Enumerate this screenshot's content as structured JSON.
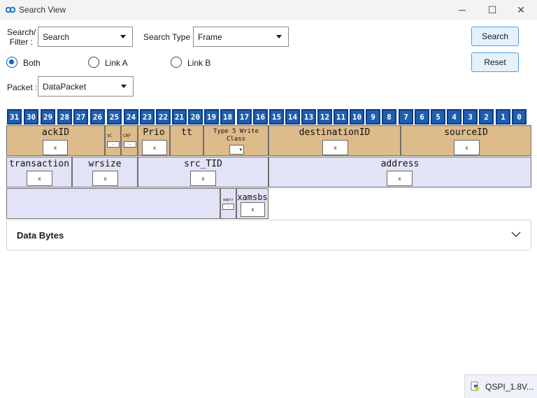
{
  "window": {
    "title": "Search View",
    "minimize_glyph": "─",
    "maximize_glyph": "☐",
    "close_glyph": "✕"
  },
  "filter": {
    "search_filter_label_line1": "Search/",
    "search_filter_label_line2": "Filter :",
    "search_filter_value": "Search",
    "search_type_label": "Search Type :",
    "search_type_value": "Frame",
    "radio_both": "Both",
    "radio_link_a": "Link A",
    "radio_link_b": "Link B",
    "radio_selected": "Both",
    "packet_label": "Packet :",
    "packet_value": "DataPacket"
  },
  "buttons": {
    "search": "Search",
    "reset": "Reset"
  },
  "bits": [
    "31",
    "30",
    "29",
    "28",
    "27",
    "26",
    "25",
    "24",
    "23",
    "22",
    "21",
    "20",
    "19",
    "18",
    "17",
    "16",
    "15",
    "14",
    "13",
    "12",
    "11",
    "10",
    "9",
    "8",
    "7",
    "6",
    "5",
    "4",
    "3",
    "2",
    "1",
    "0"
  ],
  "fields": {
    "row1": {
      "ackID": {
        "name": "ackID",
        "value": "x"
      },
      "vc": {
        "name": "VC",
        "value": "-"
      },
      "crf": {
        "name": "CRF",
        "value": "-"
      },
      "prio": {
        "name": "Prio",
        "value": "x"
      },
      "tt": {
        "name": "tt"
      },
      "type5": {
        "name_line1": "Type 5 Write",
        "name_line2": "Class",
        "value": "▾"
      },
      "destinationID": {
        "name": "destinationID",
        "value": "x"
      },
      "sourceID": {
        "name": "sourceID",
        "value": "x"
      }
    },
    "row2": {
      "transaction": {
        "name": "transaction",
        "value": "x"
      },
      "wrsize": {
        "name": "wrsize",
        "value": "x"
      },
      "src_TID": {
        "name": "src_TID",
        "value": "x"
      },
      "address": {
        "name": "address",
        "value": "x"
      }
    },
    "row3": {
      "wdptr": {
        "name": "wdptr",
        "value": "-"
      },
      "xamsbs": {
        "name": "xamsbs",
        "value": "x"
      }
    }
  },
  "data_bytes": {
    "label": "Data Bytes"
  },
  "taskbar": {
    "label": "QSPI_1.8V..."
  },
  "colors": {
    "bit_header": "#1f5fb0",
    "header_fields": "#ddbb8b",
    "body_fields": "#e3e3f7",
    "accent": "#0067c0"
  }
}
